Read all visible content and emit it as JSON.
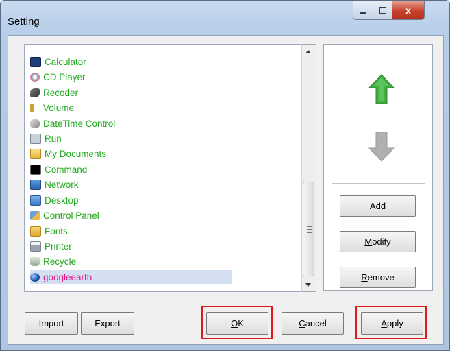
{
  "window": {
    "title": "Setting",
    "close_glyph": "x"
  },
  "list": {
    "items": [
      {
        "label": "Calculator",
        "icon": "calculator-icon"
      },
      {
        "label": "CD Player",
        "icon": "cd-player-icon"
      },
      {
        "label": "Recoder",
        "icon": "recorder-icon"
      },
      {
        "label": "Volume",
        "icon": "volume-icon"
      },
      {
        "label": "DateTime Control",
        "icon": "datetime-icon"
      },
      {
        "label": "Run",
        "icon": "run-icon"
      },
      {
        "label": "My Documents",
        "icon": "documents-folder-icon"
      },
      {
        "label": "Command",
        "icon": "command-prompt-icon"
      },
      {
        "label": "Network",
        "icon": "network-icon"
      },
      {
        "label": "Desktop",
        "icon": "desktop-icon"
      },
      {
        "label": "Control Panel",
        "icon": "control-panel-icon"
      },
      {
        "label": "Fonts",
        "icon": "fonts-folder-icon"
      },
      {
        "label": "Printer",
        "icon": "printer-icon"
      },
      {
        "label": "Recycle",
        "icon": "recycle-bin-icon"
      },
      {
        "label": "googleearth",
        "icon": "google-earth-icon",
        "selected": true
      }
    ]
  },
  "side": {
    "up_icon": "arrow-up-icon",
    "down_icon": "arrow-down-icon",
    "add": {
      "pre": "A",
      "key": "d",
      "post": "d"
    },
    "modify": {
      "pre": "",
      "key": "M",
      "post": "odify"
    },
    "remove": {
      "pre": "",
      "key": "R",
      "post": "emove"
    }
  },
  "bottom": {
    "import": "Import",
    "export": "Export",
    "ok": {
      "pre": "",
      "key": "O",
      "post": "K"
    },
    "cancel": {
      "pre": "",
      "key": "C",
      "post": "ancel"
    },
    "apply": {
      "pre": "",
      "key": "A",
      "post": "pply"
    }
  },
  "colors": {
    "item_text": "#22aa1e",
    "selected_text": "#e0198a",
    "highlight": "#e0191f",
    "arrow_up": "#3fae3f",
    "arrow_down": "#b0b0b0"
  }
}
